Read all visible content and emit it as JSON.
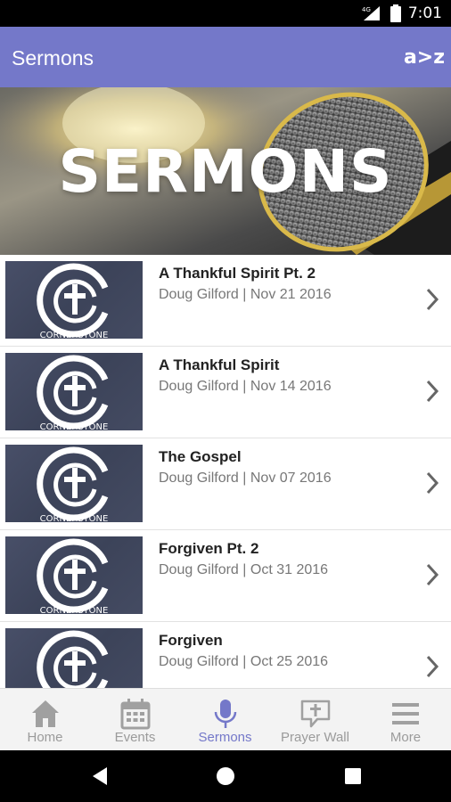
{
  "status": {
    "time": "7:01",
    "network": "4G"
  },
  "app_bar": {
    "title": "Sermons",
    "sort_label": "a>z"
  },
  "hero": {
    "text": "SERMONS"
  },
  "thumbnail_brand": "CORNERSTONE",
  "sermons": [
    {
      "title": "A Thankful Spirit Pt. 2",
      "subtitle": "Doug Gilford | Nov 21 2016"
    },
    {
      "title": "A Thankful Spirit",
      "subtitle": "Doug Gilford | Nov 14 2016"
    },
    {
      "title": "The Gospel",
      "subtitle": "Doug Gilford | Nov 07 2016"
    },
    {
      "title": "Forgiven Pt. 2",
      "subtitle": "Doug Gilford | Oct 31 2016"
    },
    {
      "title": "Forgiven",
      "subtitle": "Doug Gilford | Oct 25 2016"
    }
  ],
  "bottom_nav": [
    {
      "label": "Home",
      "icon": "home-icon",
      "active": false
    },
    {
      "label": "Events",
      "icon": "calendar-icon",
      "active": false
    },
    {
      "label": "Sermons",
      "icon": "microphone-icon",
      "active": true
    },
    {
      "label": "Prayer Wall",
      "icon": "prayer-wall-icon",
      "active": false
    },
    {
      "label": "More",
      "icon": "menu-icon",
      "active": false
    }
  ],
  "colors": {
    "accent": "#7478c9",
    "inactive": "#9b9b9b",
    "thumb_bg": "#434a61"
  }
}
